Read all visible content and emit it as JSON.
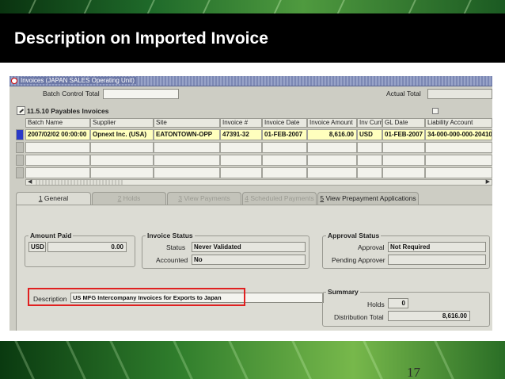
{
  "slide": {
    "title": "Description on Imported Invoice",
    "number": "17"
  },
  "window": {
    "title": "Invoices (JAPAN SALES Operating Unit)"
  },
  "batch": {
    "control_total_label": "Batch Control Total",
    "actual_total_label": "Actual Total"
  },
  "grid": {
    "title": "11.5.10 Payables Invoices",
    "columns": [
      "Batch Name",
      "Supplier",
      "Site",
      "Invoice #",
      "Invoice Date",
      "Invoice Amount",
      "Inv Curr",
      "GL Date",
      "Liability Account"
    ],
    "rows": [
      {
        "batch_name": "2007/02/02 00:00:00",
        "supplier": "Opnext Inc. (USA)",
        "site": "EATONTOWN-OPP",
        "invoice_num": "47391-32",
        "invoice_date": "01-FEB-2007",
        "invoice_amount": "8,616.00",
        "inv_curr": "USD",
        "gl_date": "01-FEB-2007",
        "liability_account": "34-000-000-000-20410"
      }
    ]
  },
  "tabs": [
    {
      "key": "1",
      "label": " General"
    },
    {
      "key": "2",
      "label": " Holds"
    },
    {
      "key": "3",
      "label": " View Payments"
    },
    {
      "key": "4",
      "label": " Scheduled Payments"
    },
    {
      "key": "5",
      "label": " View Prepayment Applications"
    }
  ],
  "general": {
    "amount_paid": {
      "title": "Amount Paid",
      "currency": "USD",
      "amount": "0.00"
    },
    "invoice_status": {
      "title": "Invoice Status",
      "status_label": "Status",
      "status_value": "Never Validated",
      "accounted_label": "Accounted",
      "accounted_value": "No"
    },
    "approval_status": {
      "title": "Approval Status",
      "approval_label": "Approval",
      "approval_value": "Not Required",
      "pending_label": "Pending Approver",
      "pending_value": ""
    },
    "description": {
      "label": "Description",
      "value": "US MFG Intercompany Invoices for Exports to Japan"
    },
    "summary": {
      "title": "Summary",
      "holds_label": "Holds",
      "holds_value": "0",
      "distribution_label": "Distribution Total",
      "distribution_value": "8,616.00"
    }
  },
  "colors": {
    "title_bar": "#000000",
    "selected_row": "#ffffbe",
    "current_row_indicator": "#2a39c8",
    "highlight_box": "#e02020"
  }
}
